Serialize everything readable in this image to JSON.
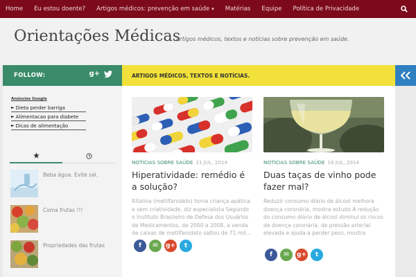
{
  "nav": {
    "items": [
      {
        "label": "Home"
      },
      {
        "label": "Eu estou doente?"
      },
      {
        "label": "Artigos médicos: prevenção em saúde"
      },
      {
        "label": "Matérias"
      },
      {
        "label": "Equipe"
      },
      {
        "label": "Política de Privacidade"
      }
    ]
  },
  "header": {
    "title": "Orientações Médicas",
    "description": "Artigos médicos, textos e notícias sobre prevenção em saúde."
  },
  "follow": {
    "label": "FOLLOW:"
  },
  "featured_bar": {
    "label": "ARTIGOS MÉDICOS, TEXTOS E NOTÍCIAS."
  },
  "ads": {
    "title": "Anúncios Google",
    "links": [
      {
        "label": "Dieta perder barriga"
      },
      {
        "label": "Alimentacao para diabete"
      },
      {
        "label": "Dicas de alimentação"
      }
    ]
  },
  "sidebar_posts": [
    {
      "title": "Beba água. Evite sal."
    },
    {
      "title": "Coma frutas !!!"
    },
    {
      "title": "Propriedades das frutas"
    }
  ],
  "posts": [
    {
      "category": "NOTÍCIAS SOBRE SAÚDE",
      "date": "21 JUL, 2014",
      "title": "Hiperatividade: remédio é a solução?",
      "excerpt": "Ritalina (metilfanidato) torna criança apática e sem criatividade, diz especialista Segundo o Instituto Brasileiro de Defesa dos Usuários de Medicamentos, de 2000 a 2008, a venda de caixas de metilfenidato saltou de 71 mil..."
    },
    {
      "category": "NOTÍCIAS SOBRE SAÚDE",
      "date": "16 JUL, 2014",
      "title": "Duas taças de vinho pode fazer mal?",
      "excerpt": "Reduzir consumo diário de álcool melhora doença coronária, mostra estudo A redução do consumo diário de álcool diminui os riscos de doença coronária, de pressão arterial elevada e ajuda a perder peso, mostra estudo..."
    }
  ],
  "share": {
    "fb": "f",
    "email": "✉",
    "gplus": "g+",
    "twitter": "t"
  },
  "colors": {
    "nav": "#7c0a1b",
    "follow": "#3a8b6a",
    "featured": "#f2e13a",
    "toggle": "#2f80c1"
  }
}
